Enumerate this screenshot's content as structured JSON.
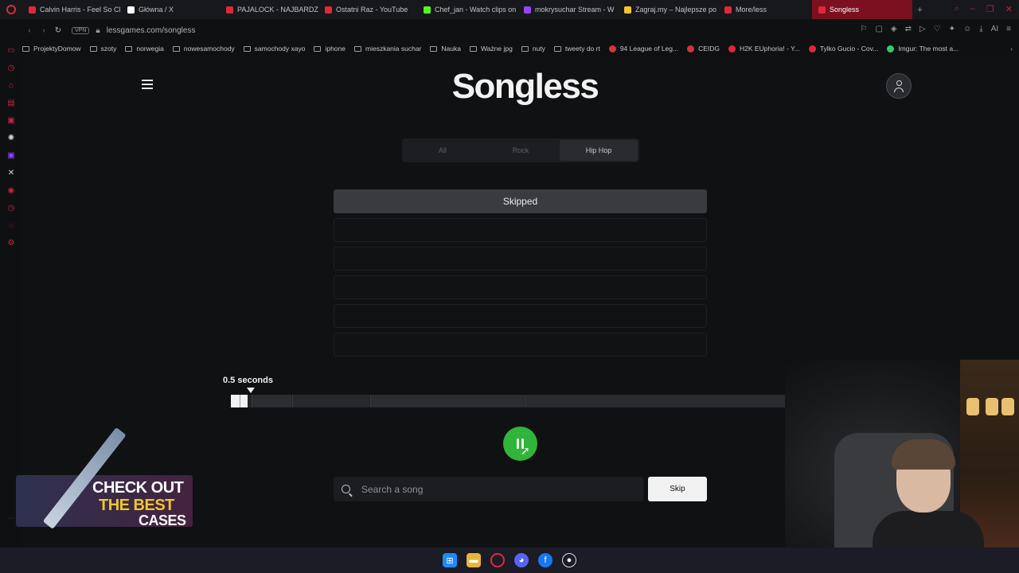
{
  "browser": {
    "tabs": [
      {
        "label": "Calvin Harris - Feel So Cl",
        "color": "#e0283a"
      },
      {
        "label": "Główna / X",
        "color": "#ffffff"
      },
      {
        "label": "PAJALOCK - NAJBARDZ",
        "color": "#e0283a"
      },
      {
        "label": "Ostatni Raz - YouTube",
        "color": "#e0283a"
      },
      {
        "label": "Chef_jan - Watch clips on",
        "color": "#53fc18"
      },
      {
        "label": "mokrysuchar Stream - W",
        "color": "#9146ff"
      },
      {
        "label": "Zagraj.my – Najlepsze po",
        "color": "#f2c52a"
      },
      {
        "label": "More/less",
        "color": "#e0283a"
      },
      {
        "label": "Songless",
        "color": "#e0283a",
        "active": true
      }
    ],
    "address": {
      "vpn": "VPN",
      "url": "lessgames.com/songless"
    },
    "bookmarks": [
      {
        "label": "ProjektyDomow",
        "type": "folder"
      },
      {
        "label": "szoty",
        "type": "folder"
      },
      {
        "label": "norwegia",
        "type": "folder"
      },
      {
        "label": "nowesamochody",
        "type": "folder"
      },
      {
        "label": "samochody xayo",
        "type": "folder"
      },
      {
        "label": "iphone",
        "type": "folder"
      },
      {
        "label": "mieszkania suchar",
        "type": "folder"
      },
      {
        "label": "Nauka",
        "type": "folder"
      },
      {
        "label": "Ważne jpg",
        "type": "folder"
      },
      {
        "label": "nuty",
        "type": "folder"
      },
      {
        "label": "tweety do rt",
        "type": "folder"
      },
      {
        "label": "94 League of Leg...",
        "type": "site",
        "color": "#d13639"
      },
      {
        "label": "CEIDG",
        "type": "site",
        "color": "#d13639"
      },
      {
        "label": "H2K EUphoria! - Y...",
        "type": "site",
        "color": "#e0283a"
      },
      {
        "label": "Tylko Gucio - Cov...",
        "type": "site",
        "color": "#e0283a"
      },
      {
        "label": "Imgur: The most a...",
        "type": "site",
        "color": "#2ecc71"
      }
    ]
  },
  "page": {
    "logo": "Songless",
    "genres": [
      {
        "label": "All",
        "active": false
      },
      {
        "label": "Rock",
        "active": false
      },
      {
        "label": "Hip Hop",
        "active": true
      }
    ],
    "guesses": [
      "Skipped",
      "",
      "",
      "",
      "",
      ""
    ],
    "duration_label": "0.5 seconds",
    "played_fraction": 0.03,
    "search_placeholder": "Search a song",
    "skip_label": "Skip"
  },
  "promo": {
    "line1": "CHECK OUT",
    "line2": "THE BEST",
    "line3": "CASES"
  },
  "colors": {
    "accent_green": "#31b43a",
    "tab_active": "#7a1020"
  }
}
